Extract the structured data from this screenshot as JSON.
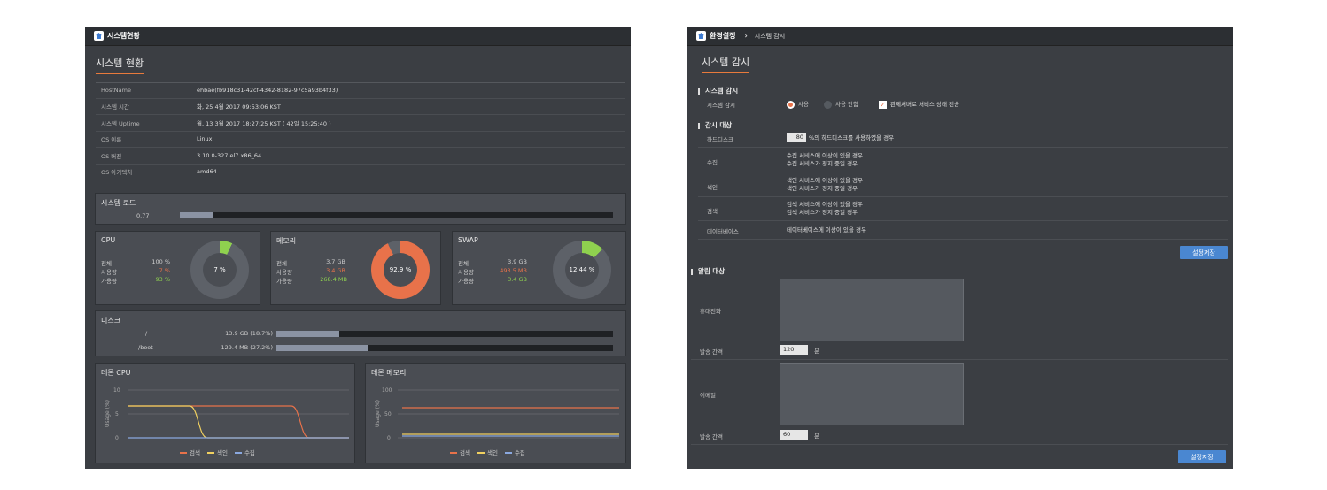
{
  "left": {
    "header_title": "시스템현황",
    "page_title": "시스템 현황",
    "info": [
      {
        "key": "HostName",
        "value": "ehbae(fb918c31-42cf-4342-8182-97c5a93b4f33)"
      },
      {
        "key": "시스템 시간",
        "value": "화, 25 4월 2017 09:53:06 KST"
      },
      {
        "key": "시스템 Uptime",
        "value": "월, 13 3월 2017 18:27:25 KST ( 42일 15:25:40 )"
      },
      {
        "key": "OS 이름",
        "value": "Linux"
      },
      {
        "key": "OS 버전",
        "value": "3.10.0-327.el7.x86_64"
      },
      {
        "key": "OS 아키텍처",
        "value": "amd64"
      }
    ],
    "load": {
      "title": "시스템 로드",
      "value_label": "0.77",
      "fraction": 0.077
    },
    "cpu": {
      "title": "CPU",
      "labels": [
        "전체",
        "사용량",
        "가용량"
      ],
      "values": [
        "100 %",
        "7 %",
        "93 %"
      ],
      "center": "7 %",
      "used_fraction": 0.07
    },
    "memory": {
      "title": "메모리",
      "labels": [
        "전체",
        "사용량",
        "가용량"
      ],
      "values": [
        "3.7 GB",
        "3.4 GB",
        "268.4 MB"
      ],
      "center": "92.9 %",
      "used_fraction": 0.929
    },
    "swap": {
      "title": "SWAP",
      "labels": [
        "전체",
        "사용량",
        "가용량"
      ],
      "values": [
        "3.9 GB",
        "493.5 MB",
        "3.4 GB"
      ],
      "center": "12.44 %",
      "used_fraction": 0.1244
    },
    "disk": {
      "title": "디스크",
      "rows": [
        {
          "mount": "/",
          "value": "13.9 GB (18.7%)",
          "fraction": 0.187
        },
        {
          "mount": "/boot",
          "value": "129.4 MB (27.2%)",
          "fraction": 0.272
        }
      ]
    },
    "daemon_cpu": {
      "title": "데몬 CPU",
      "ylabel": "Usage (%)",
      "ticks": [
        "10",
        "5",
        "0"
      ]
    },
    "daemon_mem": {
      "title": "데몬 메모리",
      "ylabel": "Usage (%)",
      "ticks": [
        "100",
        "50",
        "0"
      ]
    },
    "legend": [
      "검색",
      "색인",
      "수집"
    ]
  },
  "right": {
    "header_title": "환경설정",
    "breadcrumb_sub": "시스템 감시",
    "page_title": "시스템 감시",
    "sec1": "시스템 감시",
    "monitor_label": "시스템 감시",
    "radio_on": "사용",
    "radio_off": "사용 안함",
    "check_label": "관제서버로 서비스 상태 전송",
    "sec2": "감시 대상",
    "disk_label": "하드디스크",
    "disk_value": "80",
    "disk_text": "%의 하드디스크를 사용하였을 경우",
    "targets": [
      {
        "label": "수집",
        "line1": "수집 서비스에 이상이 있을 경우",
        "line2": "수집 서비스가 정지 중일 경우"
      },
      {
        "label": "색인",
        "line1": "색인 서비스에 이상이 있을 경우",
        "line2": "색인 서비스가 정지 중일 경우"
      },
      {
        "label": "검색",
        "line1": "검색 서비스에 이상이 있을 경우",
        "line2": "검색 서비스가 정지 중일 경우"
      }
    ],
    "db_label": "데이터베이스",
    "db_text": "데이터베이스에 이상이 있을 경우",
    "save": "설정저장",
    "sec3": "알림 대상",
    "phone_label": "휴대전화",
    "interval_label": "발송 간격",
    "phone_interval": "120",
    "unit": "분",
    "email_label": "이메일",
    "email_interval": "60"
  },
  "colors": {
    "accent": "#e87a3c",
    "search": "#e8724a",
    "index": "#f0d060",
    "collect": "#8aa8e0",
    "green": "#8fd14f",
    "button": "#4a87d1"
  }
}
